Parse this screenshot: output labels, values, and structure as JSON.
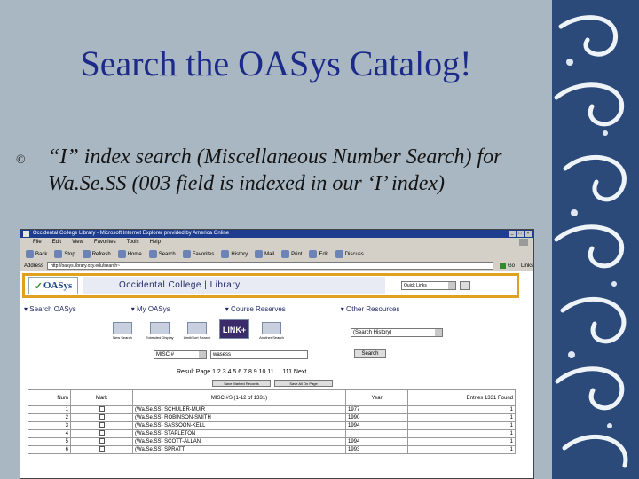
{
  "slide": {
    "title": "Search the OASys Catalog!",
    "bullet_symbol": "©",
    "bullet_text": "“I” index search (Miscellaneous Number Search) for Wa.Se.SS (003 field is indexed in our ‘I’ index)"
  },
  "browser": {
    "window_title": "Occidental College Library - Microsoft Internet Explorer provided by America Online",
    "window_buttons": [
      "_",
      "□",
      "×"
    ],
    "menu": [
      "File",
      "Edit",
      "View",
      "Favorites",
      "Tools",
      "Help"
    ],
    "toolbar": [
      "Back",
      "Stop",
      "Refresh",
      "Home",
      "Search",
      "Favorites",
      "History",
      "Mail",
      "Print",
      "Edit",
      "Discuss"
    ],
    "address_label": "Address",
    "address_value": "http://oasys.library.oxy.edu/search~",
    "go_label": "Go",
    "links_label": "Links"
  },
  "catalog": {
    "logo_text": "OASys",
    "logo_mark": "✓",
    "college_title": "Occidental College | Library",
    "quick_select": "Quick Links",
    "nav": [
      "▾ Search OASys",
      "▾ My OASys",
      "▾ Course Reserves",
      "▾ Other Resources"
    ],
    "tools": [
      "New Search",
      "Extended Display",
      "Limit/Sort Search",
      "Another Search"
    ],
    "link_plus": "LINK+",
    "history_select": "(Search History)",
    "index_select": "MISC #",
    "search_term": "wasess",
    "submit_label": "Search",
    "pager_text": "Result Page 1 2 3 4 5 6 7 8 9 10 11 ... 111 Next",
    "buttons": [
      "Save Marked Records",
      "Save All On Page"
    ],
    "table": {
      "headers": [
        "Num",
        "Mark",
        "MISC #S (1-12 of 1331)",
        "Year",
        "Entries 1331 Found"
      ],
      "rows": [
        {
          "num": "1",
          "title": "(Wa.Se.SS) SCHULER-MUIR",
          "year": "1977",
          "entries": "1"
        },
        {
          "num": "2",
          "title": "(Wa.Se.SS) ROBINSON-SMITH",
          "year": "1990",
          "entries": "1"
        },
        {
          "num": "3",
          "title": "(Wa.Se.SS) SASSOON-KELL",
          "year": "1994",
          "entries": "1"
        },
        {
          "num": "4",
          "title": "(Wa.Se.SS) STAPLETON",
          "year": "",
          "entries": "1"
        },
        {
          "num": "5",
          "title": "(Wa.Se.SS) SCOTT-ALLAN",
          "year": "1994",
          "entries": "1"
        },
        {
          "num": "6",
          "title": "(Wa.Se.SS) SPRATT",
          "year": "1993",
          "entries": "1"
        }
      ]
    }
  }
}
